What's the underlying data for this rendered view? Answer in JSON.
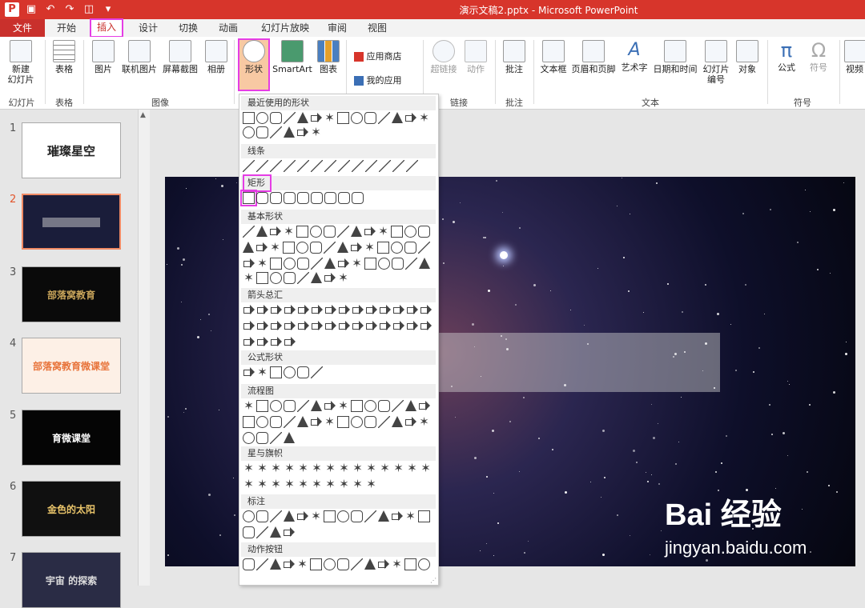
{
  "window": {
    "title": "演示文稿2.pptx - Microsoft PowerPoint"
  },
  "qat": {
    "icons": [
      "powerpoint-icon",
      "save-icon",
      "undo-icon",
      "redo-icon",
      "present-icon",
      "customize-icon"
    ]
  },
  "tabs": [
    "文件",
    "开始",
    "插入",
    "设计",
    "切换",
    "动画",
    "幻灯片放映",
    "审阅",
    "视图"
  ],
  "ribbon": {
    "new_slide": "新建\n幻灯片",
    "table": "表格",
    "picture": "图片",
    "online_picture": "联机图片",
    "screenshot": "屏幕截图",
    "album": "相册",
    "shapes": "形状",
    "smartart": "SmartArt",
    "chart": "图表",
    "app_store": "应用商店",
    "my_apps": "我的应用",
    "hyperlink": "超链接",
    "action": "动作",
    "comment": "批注",
    "textbox": "文本框",
    "header_footer": "页眉和页脚",
    "wordart": "艺术字",
    "datetime": "日期和时间",
    "slide_number": "幻灯片\n编号",
    "object": "对象",
    "equation": "公式",
    "symbol": "符号",
    "video": "视频",
    "groups": {
      "slides": "幻灯片",
      "tables": "表格",
      "images": "图像",
      "links": "链接",
      "comments": "批注",
      "text": "文本",
      "symbols": "符号"
    }
  },
  "shapes_menu": {
    "sections": [
      "最近使用的形状",
      "线条",
      "矩形",
      "基本形状",
      "箭头总汇",
      "公式形状",
      "流程图",
      "星与旗帜",
      "标注",
      "动作按钮"
    ]
  },
  "slides": [
    {
      "num": "1",
      "text": "璀璨星空",
      "bg": "#ffffff",
      "color": "#222222"
    },
    {
      "num": "2",
      "text": "",
      "bg": "#1a1d3a",
      "color": "#ffffff"
    },
    {
      "num": "3",
      "text": "部落窝教育",
      "bg": "#0a0a0a",
      "color": "#c8a45a"
    },
    {
      "num": "4",
      "text": "部落窝教育微课堂",
      "bg": "#fdf0e6",
      "color": "#e8743b"
    },
    {
      "num": "5",
      "text": "育微课堂",
      "bg": "#050505",
      "color": "#ffffff"
    },
    {
      "num": "6",
      "text": "金色的太阳",
      "bg": "#101010",
      "color": "#e9c46a"
    },
    {
      "num": "7",
      "text": "宇宙 的探索",
      "bg": "#2a2c45",
      "color": "#dddddd"
    }
  ],
  "watermark": {
    "logo": "Bai 经验",
    "url": "jingyan.baidu.com"
  }
}
